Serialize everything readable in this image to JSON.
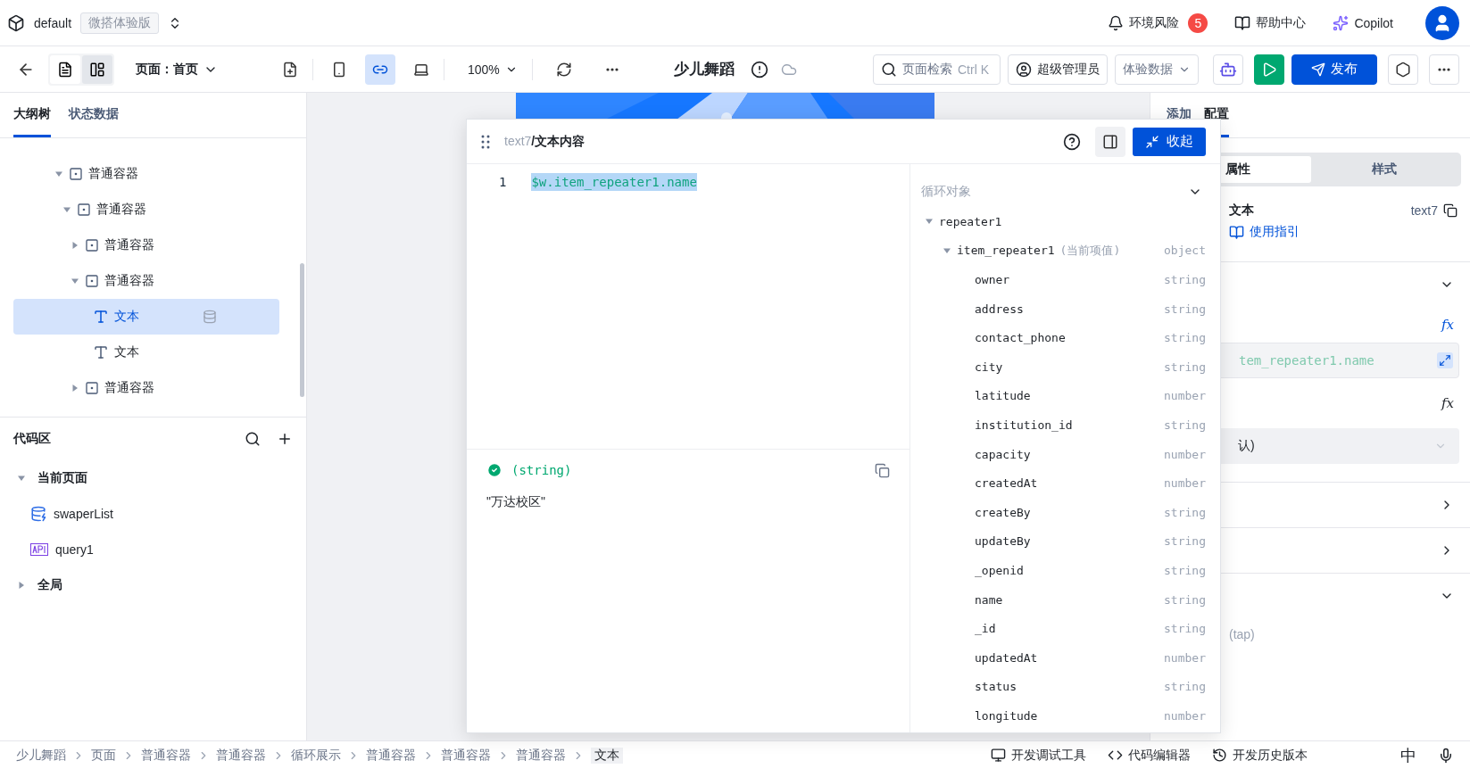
{
  "header": {
    "workspace": "default",
    "edition": "微搭体验版",
    "risk": {
      "label": "环境风险",
      "count": "5"
    },
    "help": "帮助中心",
    "copilot": "Copilot"
  },
  "toolbar": {
    "view_toggles": [
      {
        "kind": "outline",
        "selected": false
      },
      {
        "kind": "layout",
        "selected": true
      }
    ],
    "page_select": "页面：首页",
    "devices": [
      {
        "kind": "mobile",
        "selected": false
      },
      {
        "kind": "web",
        "selected": true
      },
      {
        "kind": "desktop",
        "selected": false
      }
    ],
    "zoom": "100%",
    "app_title": "少儿舞蹈",
    "search": {
      "placeholder": "页面检索",
      "shortcut": "Ctrl K"
    },
    "role": "超级管理员",
    "data_source": "体验数据",
    "publish": "发布"
  },
  "left_panel": {
    "tabs": [
      {
        "label": "大纲树",
        "selected": true
      },
      {
        "label": "状态数据",
        "selected": false
      }
    ],
    "tree": [
      {
        "label": "普通容器",
        "kind": "container",
        "expanded": true,
        "selected": false,
        "children": [
          {
            "label": "普通容器",
            "kind": "container",
            "expanded": true,
            "selected": false,
            "children": [
              {
                "label": "普通容器",
                "kind": "container",
                "expanded": false,
                "selected": false
              },
              {
                "label": "普通容器",
                "kind": "container",
                "expanded": true,
                "selected": false,
                "children": [
                  {
                    "label": "文本",
                    "kind": "text",
                    "selected": true,
                    "data_bound": true
                  },
                  {
                    "label": "文本",
                    "kind": "text",
                    "selected": false,
                    "data_bound": false
                  }
                ]
              },
              {
                "label": "普通容器",
                "kind": "container",
                "expanded": false,
                "selected": false
              }
            ]
          }
        ]
      }
    ],
    "code_area": {
      "title": "代码区",
      "groups": [
        {
          "label": "当前页面",
          "expanded": true,
          "children": [
            {
              "label": "swaperList",
              "kind": "datasource"
            },
            {
              "label": "query1",
              "kind": "api"
            }
          ]
        },
        {
          "label": "全局",
          "expanded": false
        }
      ]
    }
  },
  "dialog": {
    "path_prefix": "text7",
    "title": "/文本内容",
    "collapse": "收起",
    "code_lines": [
      {
        "number": "1",
        "text": "$w.item_repeater1.name"
      }
    ],
    "result_type": "(string)",
    "result_value": "\"万达校区\"",
    "loop": {
      "label": "循环对象",
      "tree": [
        {
          "name": "repeater1",
          "expanded": true,
          "children": [
            {
              "name": "item_repeater1",
              "note": "(当前项值)",
              "type": "object",
              "expanded": true,
              "children": [
                {
                  "name": "owner",
                  "type": "string"
                },
                {
                  "name": "address",
                  "type": "string"
                },
                {
                  "name": "contact_phone",
                  "type": "string"
                },
                {
                  "name": "city",
                  "type": "string"
                },
                {
                  "name": "latitude",
                  "type": "number"
                },
                {
                  "name": "institution_id",
                  "type": "string"
                },
                {
                  "name": "capacity",
                  "type": "number"
                },
                {
                  "name": "createdAt",
                  "type": "number"
                },
                {
                  "name": "createBy",
                  "type": "string"
                },
                {
                  "name": "updateBy",
                  "type": "string"
                },
                {
                  "name": "_openid",
                  "type": "string"
                },
                {
                  "name": "name",
                  "type": "string"
                },
                {
                  "name": "_id",
                  "type": "string"
                },
                {
                  "name": "updatedAt",
                  "type": "number"
                },
                {
                  "name": "status",
                  "type": "string"
                },
                {
                  "name": "longitude",
                  "type": "number"
                }
              ]
            }
          ]
        }
      ]
    }
  },
  "right_panel": {
    "tabs": [
      {
        "label": "添加",
        "selected": false
      },
      {
        "label": "配置",
        "selected": true
      }
    ],
    "segments": [
      {
        "label": "属性",
        "selected": true
      },
      {
        "label": "样式",
        "selected": false
      }
    ],
    "component": {
      "name": "文本",
      "id": "text7",
      "guide": "使用指引"
    },
    "field_value": "tem_repeater1.name",
    "select_value": "认)",
    "formula_buttons": [
      {
        "label": "fx",
        "active": true
      },
      {
        "label": "fx",
        "active": false
      }
    ],
    "sections": [
      {
        "expanded": true
      },
      {
        "expanded": false
      },
      {
        "expanded": false
      },
      {
        "expanded": true
      }
    ],
    "event": "(tap)"
  },
  "bottom_bar": {
    "breadcrumb": [
      "少儿舞蹈",
      "页面",
      "普通容器",
      "普通容器",
      "循环展示",
      "普通容器",
      "普通容器",
      "普通容器",
      "文本"
    ],
    "tools": [
      {
        "kind": "debug",
        "label": "开发调试工具"
      },
      {
        "kind": "code",
        "label": "代码编辑器"
      },
      {
        "kind": "history",
        "label": "开发历史版本"
      }
    ],
    "ime": "中"
  }
}
